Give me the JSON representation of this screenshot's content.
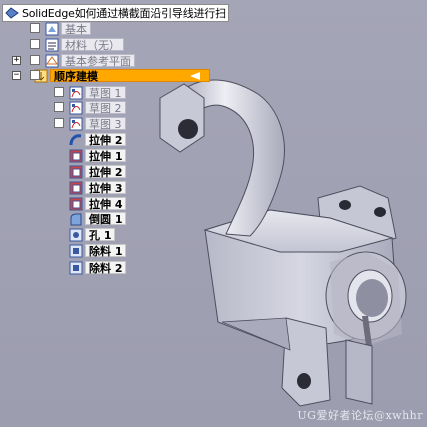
{
  "tree": {
    "root_title": "SolidEdge如何通过横截面沿引导线进行扫",
    "items": [
      {
        "label": "基本",
        "icon": "base-icon"
      },
      {
        "label": "材料（无）",
        "icon": "material-icon"
      },
      {
        "label": "基本参考平面",
        "icon": "reference-planes-icon"
      },
      {
        "label": "顺序建模",
        "icon": "sequential-modeling-icon"
      },
      {
        "label": "草图 1",
        "icon": "sketch-icon"
      },
      {
        "label": "草图 2",
        "icon": "sketch-icon"
      },
      {
        "label": "草图 3",
        "icon": "sketch-icon"
      },
      {
        "label": "拉伸 2",
        "icon": "sweep-icon"
      },
      {
        "label": "拉伸 1",
        "icon": "extrude-icon"
      },
      {
        "label": "拉伸 2",
        "icon": "extrude-icon"
      },
      {
        "label": "拉伸 3",
        "icon": "extrude-icon"
      },
      {
        "label": "拉伸 4",
        "icon": "extrude-icon"
      },
      {
        "label": "倒圆 1",
        "icon": "round-icon"
      },
      {
        "label": "孔 1",
        "icon": "hole-icon"
      },
      {
        "label": "除料 1",
        "icon": "cutout-icon"
      },
      {
        "label": "除料 2",
        "icon": "cutout-icon"
      }
    ],
    "expanders": [
      "+",
      "−"
    ]
  },
  "watermark": "UG爱好者论坛@xwhhr",
  "colors": {
    "background": "#9fa0b2",
    "selection": "#ffa800",
    "part_surface": "#c9cad6"
  }
}
